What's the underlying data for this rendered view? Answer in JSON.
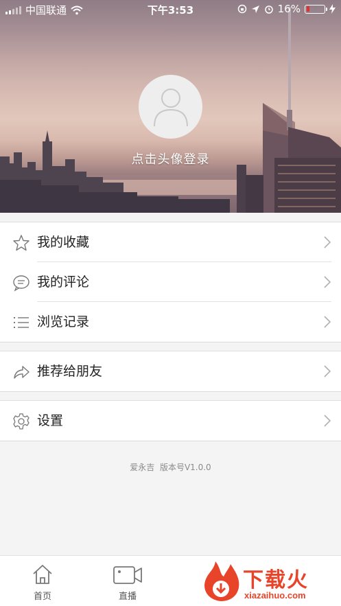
{
  "status_bar": {
    "carrier": "中国联通",
    "time": "下午3:53",
    "battery_percent": "16%",
    "battery_level": 0.16
  },
  "profile": {
    "login_prompt": "点击头像登录"
  },
  "menu": {
    "favorites": "我的收藏",
    "comments": "我的评论",
    "history": "浏览记录",
    "share": "推荐给朋友",
    "settings": "设置"
  },
  "footer": {
    "app_name": "爱永吉",
    "version": "版本号V1.0.0"
  },
  "tabs": [
    {
      "label": "首页",
      "icon": "home-icon"
    },
    {
      "label": "直播",
      "icon": "video-camera-icon"
    }
  ],
  "watermark": {
    "text": "下载火",
    "url": "xiazaihuo.com"
  },
  "colors": {
    "battery_low": "#e4312f",
    "watermark": "#e8442a",
    "divider": "#e1e1e1"
  }
}
